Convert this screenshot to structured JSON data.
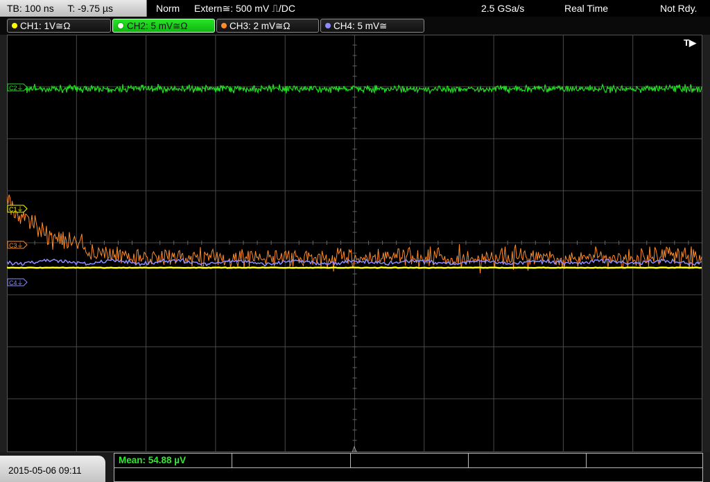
{
  "status_bar": {
    "timebase": "TB: 100 ns",
    "trigger_time": "T: -9.75 µs",
    "mode": "Norm",
    "trigger_source": "Extern≅: 500 mV ⎍/DC",
    "sample_rate": "2.5 GSa/s",
    "acq_mode": "Real Time",
    "state": "Not Rdy."
  },
  "channels": [
    {
      "label": "CH1: 1V≅Ω",
      "color": "#ffff00",
      "active": false
    },
    {
      "label": "CH2: 5 mV≅Ω",
      "color": "#22dd22",
      "active": true
    },
    {
      "label": "CH3: 2 mV≅Ω",
      "color": "#ff8c2a",
      "active": false
    },
    {
      "label": "CH4: 5 mV≅",
      "color": "#8c8cff",
      "active": false
    }
  ],
  "markers": {
    "c1": "C1⏚",
    "c2": "C2⏚",
    "c3": "C3⏚",
    "c4": "C4⏚",
    "trigger": "T▶"
  },
  "measurement": {
    "mean": "Mean: 54.88 µV"
  },
  "datetime": "2015-05-06 09:11",
  "colors": {
    "ch1": "#ffff00",
    "ch2": "#22dd22",
    "ch3": "#ff8c2a",
    "ch4": "#8c8cff",
    "grid": "#4a4a4a"
  }
}
